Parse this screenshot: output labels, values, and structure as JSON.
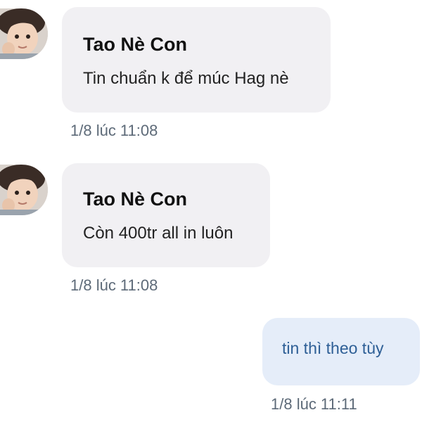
{
  "conversation": {
    "messages": [
      {
        "sender": "Tao Nè Con",
        "text": "Tin chuẩn k để múc Hag nè",
        "time": "1/8 lúc 11:08",
        "avatar_icon": "child-avatar-icon"
      },
      {
        "sender": "Tao Nè Con",
        "text": "Còn 400tr all in luôn",
        "time": "1/8 lúc 11:08",
        "avatar_icon": "child-avatar-icon"
      }
    ],
    "outgoing": {
      "text": "tin thì theo tùy",
      "time": "1/8 lúc 11:11"
    }
  },
  "colors": {
    "incoming_bubble": "#f1f0f3",
    "outgoing_bubble": "#e5edf9",
    "outgoing_text": "#2e5f96",
    "timestamp": "#5d6a78"
  }
}
